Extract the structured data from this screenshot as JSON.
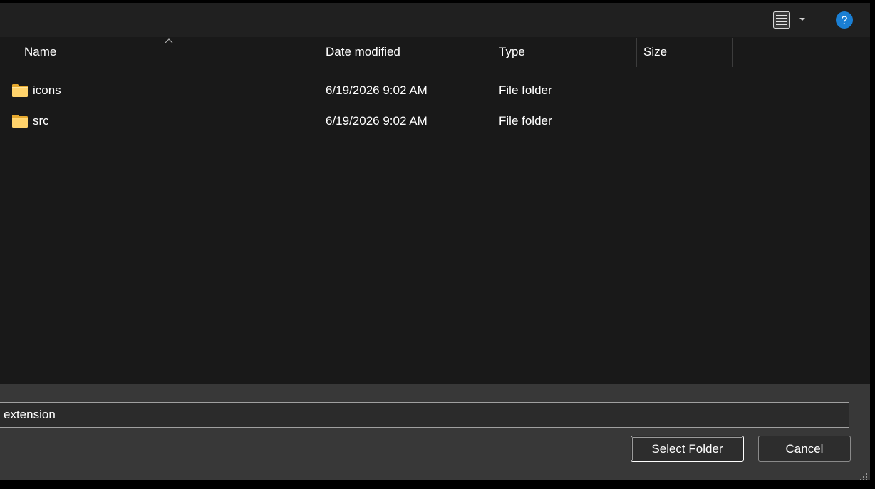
{
  "toolbar": {
    "view_icon": "details-view-icon",
    "view_dropdown_icon": "chevron-down-icon",
    "help_icon": "help-icon",
    "help_glyph": "?",
    "accent_color": "#1a7fd4"
  },
  "columns": {
    "name": "Name",
    "date_modified": "Date modified",
    "type": "Type",
    "size": "Size",
    "sort_icon": "sort-ascending-icon"
  },
  "files": [
    {
      "name": "icons",
      "date_modified": "6/19/2026 9:02 AM",
      "type": "File folder",
      "size": "",
      "icon": "folder-icon"
    },
    {
      "name": "src",
      "date_modified": "6/19/2026 9:02 AM",
      "type": "File folder",
      "size": "",
      "icon": "folder-icon"
    }
  ],
  "footer": {
    "folder_name_value": "extension",
    "select_button_label": "Select Folder",
    "cancel_button_label": "Cancel"
  }
}
